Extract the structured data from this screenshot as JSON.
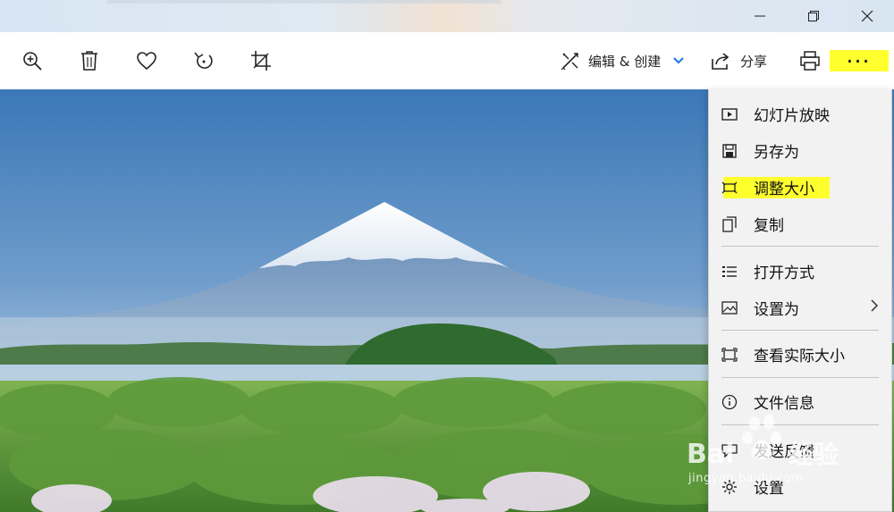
{
  "window": {
    "minimize_icon": "minimize-icon",
    "maximize_icon": "restore-icon",
    "close_icon": "close-icon"
  },
  "toolbar": {
    "zoom_icon": "zoom-in-icon",
    "delete_icon": "trash-icon",
    "favorite_icon": "heart-icon",
    "rotate_icon": "rotate-icon",
    "crop_icon": "crop-icon",
    "edit_create_label": "编辑 & 创建",
    "share_label": "分享",
    "print_icon": "printer-icon",
    "more_label": "···",
    "accent_highlight": "#ffff2e",
    "accent_blue": "#1a73e8"
  },
  "menu": {
    "items": [
      {
        "label": "幻灯片放映",
        "icon": "slideshow-icon"
      },
      {
        "label": "另存为",
        "icon": "save-icon"
      },
      {
        "label": "调整大小",
        "icon": "resize-icon"
      },
      {
        "label": "复制",
        "icon": "copy-icon"
      },
      {
        "label": "打开方式",
        "icon": "open-with-icon"
      },
      {
        "label": "设置为",
        "icon": "set-as-icon"
      },
      {
        "label": "查看实际大小",
        "icon": "actual-size-icon"
      },
      {
        "label": "文件信息",
        "icon": "info-icon"
      },
      {
        "label": "发送反馈",
        "icon": "feedback-icon"
      },
      {
        "label": "设置",
        "icon": "settings-icon"
      }
    ]
  },
  "watermark": {
    "logo_text": "Bai 经验",
    "url": "jingyan.baidu.com"
  }
}
